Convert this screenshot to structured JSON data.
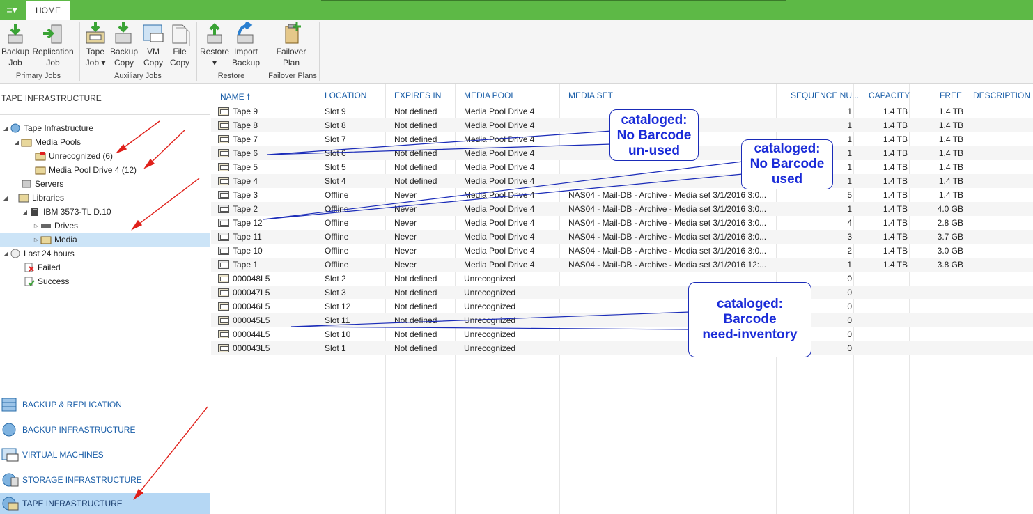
{
  "ribbon": {
    "app_menu": "≡▾",
    "tab_home": "HOME",
    "buttons": {
      "backup_job": "Backup\nJob",
      "replication_job": "Replication\nJob",
      "tape_job": "Tape\nJob ▾",
      "backup_copy": "Backup\nCopy",
      "vm_copy": "VM\nCopy",
      "file_copy": "File\nCopy",
      "restore": "Restore\n▾",
      "import_backup": "Import\nBackup",
      "failover_plan": "Failover\nPlan"
    },
    "groups": {
      "primary": "Primary Jobs",
      "auxiliary": "Auxiliary Jobs",
      "restore": "Restore",
      "failover": "Failover Plans"
    }
  },
  "left": {
    "title": "TAPE INFRASTRUCTURE",
    "tree": {
      "tape_infrastructure": "Tape Infrastructure",
      "media_pools": "Media Pools",
      "unrecognized": "Unrecognized (6)",
      "media_pool_drive4": "Media Pool Drive 4 (12)",
      "servers": "Servers",
      "libraries": "Libraries",
      "ibm": "IBM 3573-TL D.10",
      "drives": "Drives",
      "media": "Media",
      "last24": "Last 24 hours",
      "failed": "Failed",
      "success": "Success"
    },
    "nav": {
      "backup_replication": "BACKUP & REPLICATION",
      "backup_infrastructure": "BACKUP INFRASTRUCTURE",
      "virtual_machines": "VIRTUAL MACHINES",
      "storage_infrastructure": "STORAGE INFRASTRUCTURE",
      "tape_infrastructure": "TAPE INFRASTRUCTURE"
    }
  },
  "grid": {
    "columns": {
      "name": "NAME",
      "sort_arrow": "🠕",
      "location": "LOCATION",
      "expires": "EXPIRES IN",
      "pool": "MEDIA POOL",
      "set": "MEDIA SET",
      "seq": "SEQUENCE NU...",
      "capacity": "CAPACITY",
      "free": "FREE",
      "desc": "DESCRIPTION"
    },
    "rows": [
      {
        "name": "Tape 9",
        "location": "Slot 9",
        "expires": "Not defined",
        "pool": "Media Pool Drive 4",
        "set": "",
        "seq": "1",
        "capacity": "1.4 TB",
        "free": "1.4 TB"
      },
      {
        "name": "Tape 8",
        "location": "Slot 8",
        "expires": "Not defined",
        "pool": "Media Pool Drive 4",
        "set": "",
        "seq": "1",
        "capacity": "1.4 TB",
        "free": "1.4 TB"
      },
      {
        "name": "Tape 7",
        "location": "Slot 7",
        "expires": "Not defined",
        "pool": "Media Pool Drive 4",
        "set": "",
        "seq": "1",
        "capacity": "1.4 TB",
        "free": "1.4 TB"
      },
      {
        "name": "Tape 6",
        "location": "Slot 6",
        "expires": "Not defined",
        "pool": "Media Pool Drive 4",
        "set": "",
        "seq": "1",
        "capacity": "1.4 TB",
        "free": "1.4 TB"
      },
      {
        "name": "Tape 5",
        "location": "Slot 5",
        "expires": "Not defined",
        "pool": "Media Pool Drive 4",
        "set": "",
        "seq": "1",
        "capacity": "1.4 TB",
        "free": "1.4 TB"
      },
      {
        "name": "Tape 4",
        "location": "Slot 4",
        "expires": "Not defined",
        "pool": "Media Pool Drive 4",
        "set": "",
        "seq": "1",
        "capacity": "1.4 TB",
        "free": "1.4 TB"
      },
      {
        "name": "Tape 3",
        "location": "Offline",
        "expires": "Never",
        "pool": "Media Pool Drive 4",
        "set": "NAS04 - Mail-DB - Archive - Media set 3/1/2016 3:0...",
        "seq": "5",
        "capacity": "1.4 TB",
        "free": "1.4 TB"
      },
      {
        "name": "Tape 2",
        "location": "Offline",
        "expires": "Never",
        "pool": "Media Pool Drive 4",
        "set": "NAS04 - Mail-DB - Archive - Media set 3/1/2016 3:0...",
        "seq": "1",
        "capacity": "1.4 TB",
        "free": "4.0 GB"
      },
      {
        "name": "Tape 12",
        "location": "Offline",
        "expires": "Never",
        "pool": "Media Pool Drive 4",
        "set": "NAS04 - Mail-DB - Archive - Media set 3/1/2016 3:0...",
        "seq": "4",
        "capacity": "1.4 TB",
        "free": "2.8 GB"
      },
      {
        "name": "Tape 11",
        "location": "Offline",
        "expires": "Never",
        "pool": "Media Pool Drive 4",
        "set": "NAS04 - Mail-DB - Archive - Media set 3/1/2016 3:0...",
        "seq": "3",
        "capacity": "1.4 TB",
        "free": "3.7 GB"
      },
      {
        "name": "Tape 10",
        "location": "Offline",
        "expires": "Never",
        "pool": "Media Pool Drive 4",
        "set": "NAS04 - Mail-DB - Archive - Media set 3/1/2016 3:0...",
        "seq": "2",
        "capacity": "1.4 TB",
        "free": "3.0 GB"
      },
      {
        "name": "Tape 1",
        "location": "Offline",
        "expires": "Never",
        "pool": "Media Pool Drive 4",
        "set": "NAS04 - Mail-DB - Archive - Media set 3/1/2016 12:...",
        "seq": "1",
        "capacity": "1.4 TB",
        "free": "3.8 GB"
      },
      {
        "name": "000048L5",
        "location": "Slot 2",
        "expires": "Not defined",
        "pool": "Unrecognized",
        "set": "",
        "seq": "0",
        "capacity": "",
        "free": ""
      },
      {
        "name": "000047L5",
        "location": "Slot 3",
        "expires": "Not defined",
        "pool": "Unrecognized",
        "set": "",
        "seq": "0",
        "capacity": "",
        "free": ""
      },
      {
        "name": "000046L5",
        "location": "Slot 12",
        "expires": "Not defined",
        "pool": "Unrecognized",
        "set": "",
        "seq": "0",
        "capacity": "",
        "free": ""
      },
      {
        "name": "000045L5",
        "location": "Slot 11",
        "expires": "Not defined",
        "pool": "Unrecognized",
        "set": "",
        "seq": "0",
        "capacity": "",
        "free": ""
      },
      {
        "name": "000044L5",
        "location": "Slot 10",
        "expires": "Not defined",
        "pool": "Unrecognized",
        "set": "",
        "seq": "0",
        "capacity": "",
        "free": ""
      },
      {
        "name": "000043L5",
        "location": "Slot 1",
        "expires": "Not defined",
        "pool": "Unrecognized",
        "set": "",
        "seq": "0",
        "capacity": "",
        "free": ""
      }
    ]
  },
  "annotations": {
    "callout1": "cataloged:\nNo Barcode\nun-used",
    "callout2": "cataloged:\nNo Barcode\nused",
    "callout3": "cataloged:\nBarcode\nneed-inventory"
  },
  "colors": {
    "brand_green": "#5db946",
    "link_blue": "#1a5ea8",
    "selection": "#cce4f7",
    "annotation_blue": "#1a2bd8",
    "arrow_red": "#e0201a"
  }
}
